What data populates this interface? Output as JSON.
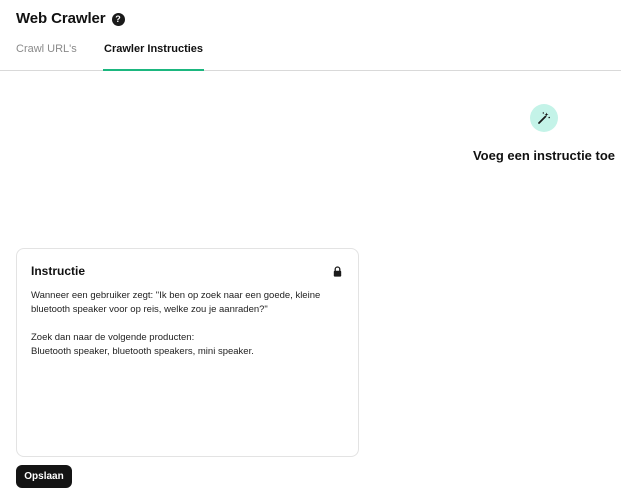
{
  "header": {
    "title": "Web Crawler",
    "help_icon_glyph": "?"
  },
  "tabs": [
    {
      "label": "Crawl URL's",
      "active": false
    },
    {
      "label": "Crawler Instructies",
      "active": true
    }
  ],
  "add_instruction": {
    "icon": "magic-wand-icon",
    "label": "Voeg een instructie toe"
  },
  "instruction_card": {
    "title": "Instructie",
    "lock_icon": "lock-icon",
    "paragraph_1_line_1": "Wanneer een gebruiker zegt: \"Ik ben op zoek naar een goede, kleine",
    "paragraph_1_line_2": "bluetooth speaker voor op reis, welke zou je aanraden?\"",
    "paragraph_2_line_1": "Zoek dan naar de volgende producten:",
    "paragraph_2_line_2": "Bluetooth speaker, bluetooth speakers, mini speaker."
  },
  "footer": {
    "save_label": "Opslaan"
  },
  "colors": {
    "accent_tab_underline": "#1bb77f",
    "wand_circle_bg": "#c4f3e8",
    "button_bg": "#141414"
  }
}
